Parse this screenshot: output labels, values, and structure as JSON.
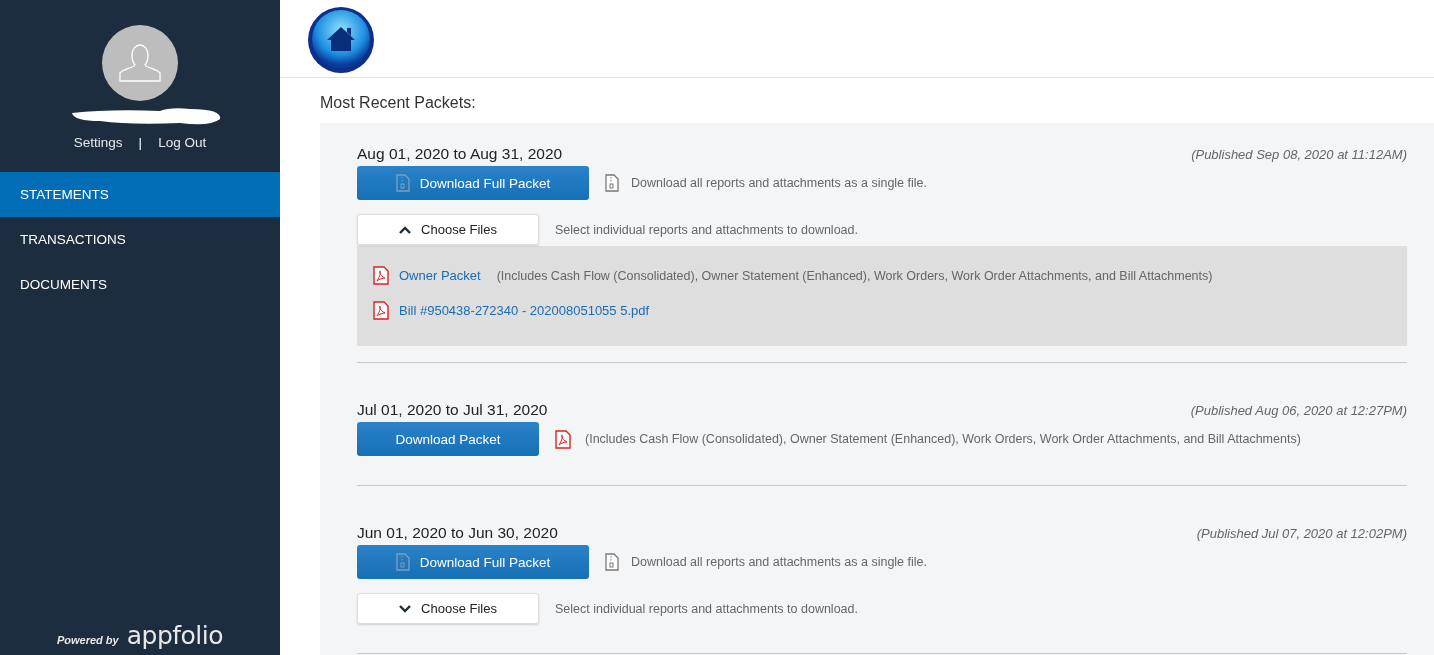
{
  "sidebar": {
    "links": [
      {
        "label": "Settings"
      },
      {
        "label": "Log Out"
      }
    ],
    "separator": "|",
    "nav": [
      {
        "label": "STATEMENTS",
        "selected": true
      },
      {
        "label": "TRANSACTIONS",
        "selected": false
      },
      {
        "label": "DOCUMENTS",
        "selected": false
      }
    ],
    "powered_by": "Powered by",
    "brand": "appfolio"
  },
  "heading": "Most Recent Packets:",
  "packets": [
    {
      "kind": "full",
      "period": "Aug 01, 2020 to Aug 31, 2020",
      "published": "(Published Sep 08, 2020 at 11:12AM)",
      "button": "Download Full Packet",
      "note": "Download all reports and attachments as a single file.",
      "choose_label": "Choose Files",
      "choose_note": "Select individual reports and attachments to download.",
      "expanded": true,
      "files": [
        {
          "name": "Owner Packet",
          "description": "(Includes Cash Flow (Consolidated), Owner Statement (Enhanced), Work Orders, Work Order Attachments, and Bill Attachments)"
        },
        {
          "name": "Bill #950438-272340 - 202008051055 5.pdf"
        }
      ]
    },
    {
      "kind": "single",
      "period": "Jul 01, 2020 to Jul 31, 2020",
      "published": "(Published Aug 06, 2020 at 12:27PM)",
      "button": "Download Packet",
      "note": "(Includes Cash Flow (Consolidated), Owner Statement (Enhanced), Work Orders, Work Order Attachments, and Bill Attachments)"
    },
    {
      "kind": "full",
      "period": "Jun 01, 2020 to Jun 30, 2020",
      "published": "(Published Jul 07, 2020 at 12:02PM)",
      "button": "Download Full Packet",
      "note": "Download all reports and attachments as a single file.",
      "choose_label": "Choose Files",
      "choose_note": "Select individual reports and attachments to download.",
      "expanded": false
    }
  ]
}
